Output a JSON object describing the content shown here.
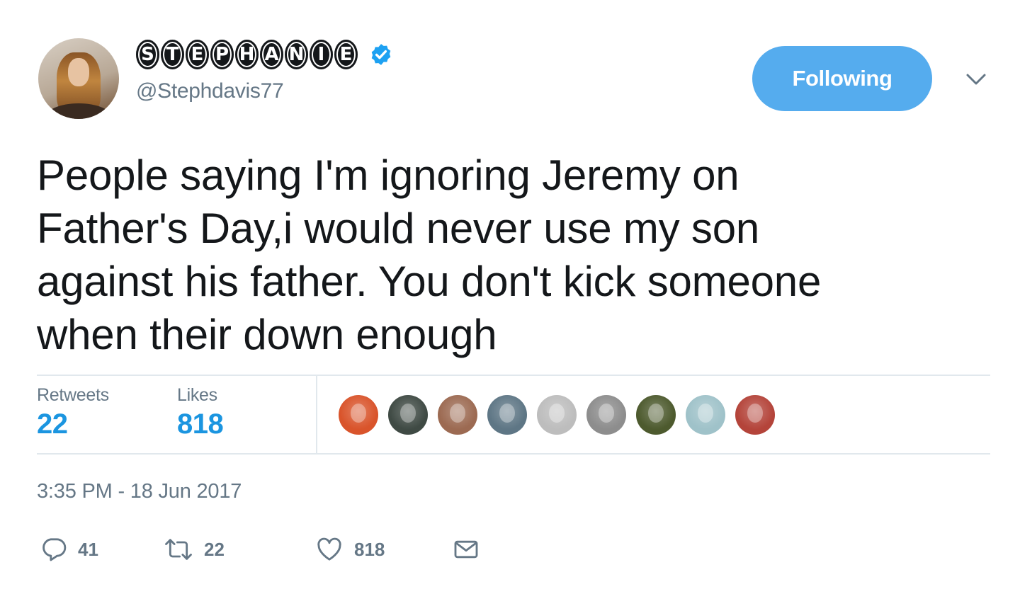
{
  "author": {
    "display_name_letters": [
      "S",
      "T",
      "E",
      "P",
      "H",
      "A",
      "N",
      "I",
      "E"
    ],
    "handle": "@Stephdavis77",
    "verified": true
  },
  "follow_button": {
    "label": "Following",
    "color": "#55acee"
  },
  "tweet": {
    "lines": [
      "People saying I'm ignoring Jeremy on",
      "Father's Day,i would never use my son",
      "against his father. You don't kick someone",
      "when their down enough"
    ]
  },
  "stats": {
    "retweets_label": "Retweets",
    "retweets_count": "22",
    "likes_label": "Likes",
    "likes_count": "818",
    "count_color": "#1b95e0"
  },
  "likers": [
    {
      "color": "#d9542b"
    },
    {
      "color": "#3f4a44"
    },
    {
      "color": "#9c6a52"
    },
    {
      "color": "#5e7685"
    },
    {
      "color": "#bdbdbd"
    },
    {
      "color": "#8d8d8d"
    },
    {
      "color": "#4d5a2e"
    },
    {
      "color": "#9fc2c9"
    },
    {
      "color": "#b4443a"
    }
  ],
  "timestamp": "3:35 PM - 18 Jun 2017",
  "actions": {
    "reply_count": "41",
    "retweet_count": "22",
    "like_count": "818"
  },
  "icons": {
    "verified": "verified-badge-icon",
    "caret": "chevron-down-icon",
    "reply": "reply-icon",
    "retweet": "retweet-icon",
    "like": "heart-icon",
    "dm": "envelope-icon"
  }
}
